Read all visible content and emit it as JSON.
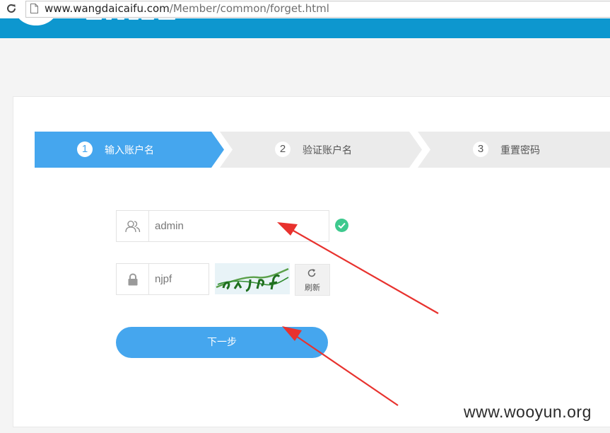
{
  "browser": {
    "url_host": "www.wangdaicaifu.com",
    "url_path": "/Member/common/forget.html"
  },
  "steps": [
    {
      "number": "1",
      "label": "输入账户名",
      "active": true
    },
    {
      "number": "2",
      "label": "验证账户名",
      "active": false
    },
    {
      "number": "3",
      "label": "重置密码",
      "active": false
    }
  ],
  "form": {
    "username_value": "admin",
    "username_valid": true,
    "captcha_input_value": "njpf",
    "captcha_image_text": "njpf",
    "refresh_label": "刷新",
    "next_label": "下一步"
  },
  "watermark": "www.wooyun.org",
  "colors": {
    "header": "#0d97cf",
    "accent": "#45a6ee",
    "step_inactive": "#ebebeb",
    "success": "#3ec98e",
    "arrow": "#e8322e"
  }
}
